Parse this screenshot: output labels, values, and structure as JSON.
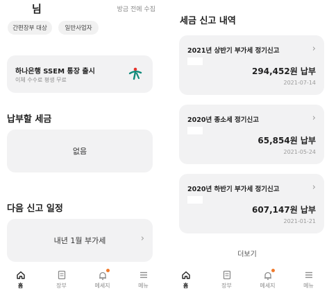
{
  "left": {
    "user_name": "님",
    "updated_text": "방금 전에 수집",
    "chips": [
      "간편장부 대상",
      "일반사업자"
    ],
    "bank_card": {
      "title": "하나은행 SSEM 통장 출시",
      "subtitle": "이체 수수료 평생 무료",
      "logo_icon": "hana-bank-logo-icon",
      "logo_color": "#0f8a7a"
    },
    "tax_section": {
      "title": "납부할 세금",
      "value": "없음"
    },
    "schedule_section": {
      "title": "다음 신고 일정",
      "value": "내년 1월 부가세"
    },
    "nav": [
      {
        "label": "홈",
        "icon": "home-icon",
        "active": true
      },
      {
        "label": "장부",
        "icon": "ledger-icon",
        "active": false
      },
      {
        "label": "메세지",
        "icon": "bell-icon",
        "active": false,
        "badge": true
      },
      {
        "label": "메뉴",
        "icon": "menu-icon",
        "active": false
      }
    ]
  },
  "right": {
    "title": "세금 신고 내역",
    "history": [
      {
        "name": "2021년 상반기 부가세 정기신고",
        "amount": "294,452원 납부",
        "date": "2021-07-14"
      },
      {
        "name": "2020년 종소세 정기신고",
        "amount": "65,854원 납부",
        "date": "2021-05-24"
      },
      {
        "name": "2020년 하반기 부가세 정기신고",
        "amount": "607,147원 납부",
        "date": "2021-01-21"
      }
    ],
    "more_label": "더보기",
    "nav": [
      {
        "label": "홈",
        "icon": "home-icon",
        "active": true
      },
      {
        "label": "장부",
        "icon": "ledger-icon",
        "active": false
      },
      {
        "label": "메세지",
        "icon": "bell-icon",
        "active": false,
        "badge": true
      },
      {
        "label": "메뉴",
        "icon": "menu-icon",
        "active": false
      }
    ]
  },
  "colors": {
    "card_bg": "#f2f2f3",
    "badge": "#f07a2c",
    "text_muted": "#8a8a8a"
  }
}
